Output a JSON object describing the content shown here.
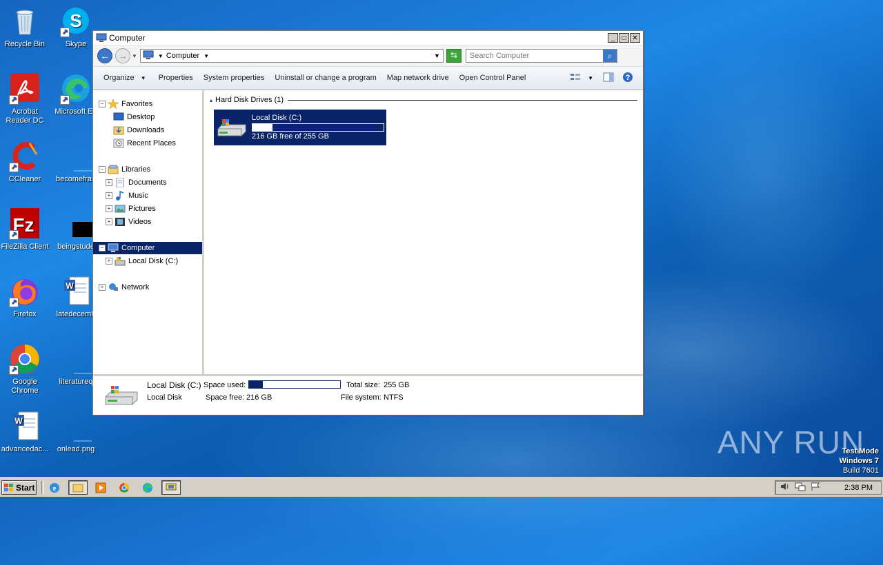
{
  "desktop": {
    "icons": [
      {
        "label": "Recycle Bin"
      },
      {
        "label": "Skype"
      },
      {
        "label": "Acrobat Reader DC"
      },
      {
        "label": "Microsoft Ed"
      },
      {
        "label": "CCleaner"
      },
      {
        "label": "becomefran"
      },
      {
        "label": "FileZilla Client"
      },
      {
        "label": "beingstude"
      },
      {
        "label": "Firefox"
      },
      {
        "label": "latedecemb"
      },
      {
        "label": "Google Chrome"
      },
      {
        "label": "literatureq"
      },
      {
        "label": "advancedac..."
      },
      {
        "label": "onlead.png"
      }
    ],
    "watermark": "ANY RUN",
    "testmode": {
      "line1": "Test Mode",
      "line2": "Windows 7",
      "line3": "Build 7601"
    }
  },
  "window": {
    "title": "Computer",
    "address": {
      "crumb": "Computer"
    },
    "search": {
      "placeholder": "Search Computer"
    },
    "commands": [
      "Organize",
      "Properties",
      "System properties",
      "Uninstall or change a program",
      "Map network drive",
      "Open Control Panel"
    ],
    "nav": {
      "favorites": "Favorites",
      "desktop": "Desktop",
      "downloads": "Downloads",
      "recent": "Recent Places",
      "libraries": "Libraries",
      "documents": "Documents",
      "music": "Music",
      "pictures": "Pictures",
      "videos": "Videos",
      "computer": "Computer",
      "localdisk": "Local Disk (C:)",
      "network": "Network"
    },
    "group_header": "Hard Disk Drives (1)",
    "drive": {
      "name": "Local Disk (C:)",
      "free_text": "216 GB free of 255 GB",
      "used_fraction": 0.153
    },
    "details": {
      "title": "Local Disk (C:)",
      "subtitle": "Local Disk",
      "space_used_label": "Space used:",
      "space_free_label": "Space free:",
      "space_free_value": "216 GB",
      "total_size_label": "Total size:",
      "total_size_value": "255 GB",
      "fs_label": "File system:",
      "fs_value": "NTFS"
    }
  },
  "taskbar": {
    "start_label": "Start",
    "clock": "2:38 PM"
  },
  "colors": {
    "selection": "#0a246a",
    "desktop": "#1565c0"
  }
}
